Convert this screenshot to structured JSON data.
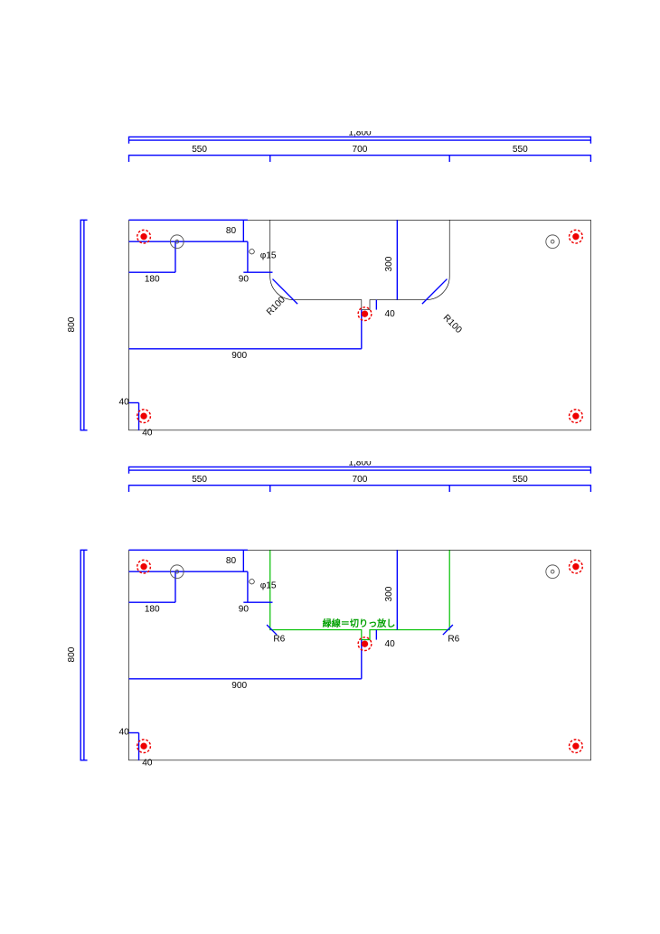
{
  "drawing1": {
    "dims": {
      "overall_w": "1,800",
      "overall_h": "800",
      "w_left": "550",
      "w_mid": "700",
      "w_right": "550",
      "d80": "80",
      "d180": "180",
      "d90": "90",
      "d300": "300",
      "d40_notch": "40",
      "d900": "900",
      "corner_in": "40",
      "corner_up": "40",
      "r_left": "R100",
      "r_right": "R100",
      "phi": "φ15"
    }
  },
  "drawing2": {
    "dims": {
      "overall_w": "1,800",
      "overall_h": "800",
      "w_left": "550",
      "w_mid": "700",
      "w_right": "550",
      "d80": "80",
      "d180": "180",
      "d90": "90",
      "d300": "300",
      "d40_notch": "40",
      "d900": "900",
      "corner_in": "40",
      "corner_up": "40",
      "r_left": "R6",
      "r_right": "R6",
      "phi": "φ15",
      "green_note": "緑線＝切りっ放し"
    }
  }
}
